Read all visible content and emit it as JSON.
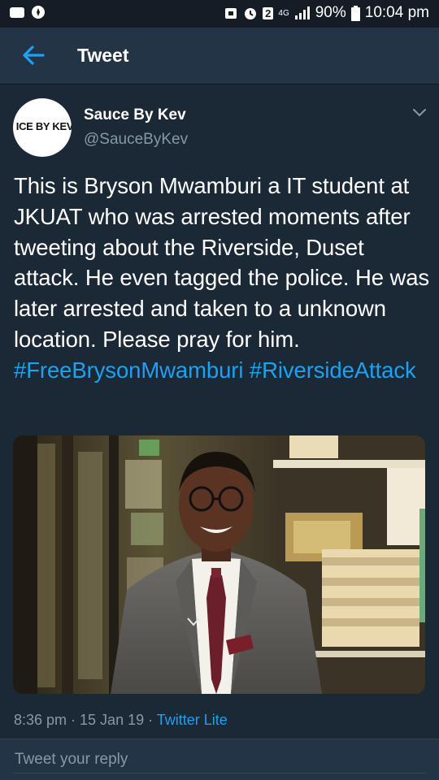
{
  "status_bar": {
    "network": "4G",
    "sim": "2",
    "battery": "90%",
    "time": "10:04 pm"
  },
  "header": {
    "back_icon": "arrow-left-icon",
    "title": "Tweet"
  },
  "tweet": {
    "avatar_text": "ICE BY KEV",
    "author_name": "Sauce By Kev",
    "author_handle": "@SauceByKev",
    "menu_icon": "chevron-down-icon",
    "body_text": "This is Bryson Mwamburi a IT student at JKUAT who was arrested moments after tweeting about the Riverside, Duset attack. He even tagged the police. He was later arrested and taken to a unknown location. Please pray for him.",
    "hashtags": [
      "#FreeBrysonMwamburi",
      "#RiversideAttack"
    ],
    "timestamp": "8:36 pm · 15 Jan 19 · ",
    "source": "Twitter Lite"
  },
  "reply": {
    "placeholder": "Tweet your reply"
  },
  "colors": {
    "background": "#141d26",
    "card": "#1b2836",
    "header": "#243447",
    "accent": "#1da1f2",
    "muted": "#8899a6"
  }
}
